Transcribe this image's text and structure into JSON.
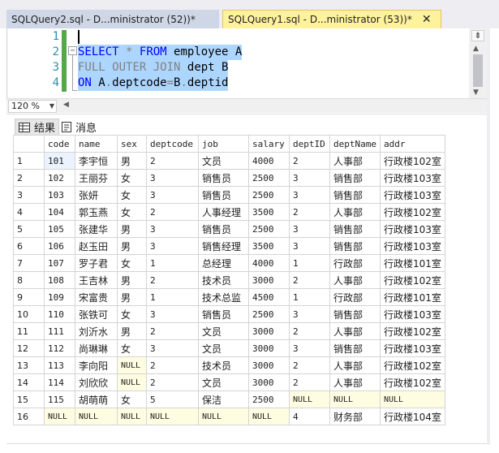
{
  "tabs": [
    {
      "label": "SQLQuery2.sql - D...ministrator (52))*",
      "active": false
    },
    {
      "label": "SQLQuery1.sql - D...ministrator (53))*",
      "active": true,
      "close": "✕"
    }
  ],
  "editor": {
    "line_numbers": [
      "1",
      "2",
      "3",
      "4"
    ],
    "lines": [
      [],
      [
        {
          "t": "SELECT",
          "c": "kw"
        },
        {
          "t": " ",
          "c": "plain"
        },
        {
          "t": "*",
          "c": "gray"
        },
        {
          "t": " ",
          "c": "plain"
        },
        {
          "t": "FROM",
          "c": "kw"
        },
        {
          "t": " employee A",
          "c": "plain"
        }
      ],
      [
        {
          "t": "FULL",
          "c": "gray"
        },
        {
          "t": " ",
          "c": "plain"
        },
        {
          "t": "OUTER",
          "c": "gray"
        },
        {
          "t": " ",
          "c": "plain"
        },
        {
          "t": "JOIN",
          "c": "gray"
        },
        {
          "t": " dept B",
          "c": "plain"
        }
      ],
      [
        {
          "t": "ON",
          "c": "kw"
        },
        {
          "t": " A",
          "c": "plain"
        },
        {
          "t": ".",
          "c": "gray"
        },
        {
          "t": "deptcode",
          "c": "plain"
        },
        {
          "t": "=",
          "c": "gray"
        },
        {
          "t": "B",
          "c": "plain"
        },
        {
          "t": ".",
          "c": "gray"
        },
        {
          "t": "deptid",
          "c": "plain"
        }
      ]
    ],
    "fold_symbol": "−"
  },
  "zoom": {
    "value": "120 %"
  },
  "results_tabs": {
    "results": "结果",
    "messages": "消息"
  },
  "grid": {
    "columns": [
      "code",
      "name",
      "sex",
      "deptcode",
      "job",
      "salary",
      "deptID",
      "deptName",
      "addr"
    ],
    "rows": [
      [
        "1",
        "101",
        "李宇恒",
        "男",
        "2",
        "文员",
        "4000",
        "2",
        "人事部",
        "行政楼102室"
      ],
      [
        "2",
        "102",
        "王丽芬",
        "女",
        "3",
        "销售员",
        "2500",
        "3",
        "销售部",
        "行政楼103室"
      ],
      [
        "3",
        "103",
        "张妍",
        "女",
        "3",
        "销售员",
        "2500",
        "3",
        "销售部",
        "行政楼103室"
      ],
      [
        "4",
        "104",
        "郭玉燕",
        "女",
        "2",
        "人事经理",
        "3500",
        "2",
        "人事部",
        "行政楼102室"
      ],
      [
        "5",
        "105",
        "张建华",
        "男",
        "3",
        "销售员",
        "2500",
        "3",
        "销售部",
        "行政楼103室"
      ],
      [
        "6",
        "106",
        "赵玉田",
        "男",
        "3",
        "销售经理",
        "3500",
        "3",
        "销售部",
        "行政楼103室"
      ],
      [
        "7",
        "107",
        "罗子君",
        "女",
        "1",
        "总经理",
        "4000",
        "1",
        "行政部",
        "行政楼101室"
      ],
      [
        "8",
        "108",
        "王吉林",
        "男",
        "2",
        "技术员",
        "3000",
        "2",
        "人事部",
        "行政楼102室"
      ],
      [
        "9",
        "109",
        "宋富贵",
        "男",
        "1",
        "技术总监",
        "4500",
        "1",
        "行政部",
        "行政楼101室"
      ],
      [
        "10",
        "110",
        "张铁可",
        "女",
        "3",
        "销售员",
        "2500",
        "3",
        "销售部",
        "行政楼103室"
      ],
      [
        "11",
        "111",
        "刘沂水",
        "男",
        "2",
        "文员",
        "3000",
        "2",
        "人事部",
        "行政楼102室"
      ],
      [
        "12",
        "112",
        "尚琳琳",
        "女",
        "3",
        "文员",
        "3000",
        "3",
        "销售部",
        "行政楼103室"
      ],
      [
        "13",
        "113",
        "李向阳",
        "NULL",
        "2",
        "技术员",
        "3000",
        "2",
        "人事部",
        "行政楼102室"
      ],
      [
        "14",
        "114",
        "刘欣欣",
        "NULL",
        "2",
        "文员",
        "3000",
        "2",
        "人事部",
        "行政楼102室"
      ],
      [
        "15",
        "115",
        "胡萌萌",
        "女",
        "5",
        "保洁",
        "2500",
        "NULL",
        "NULL",
        "NULL"
      ],
      [
        "16",
        "NULL",
        "NULL",
        "NULL",
        "NULL",
        "NULL",
        "NULL",
        "4",
        "财务部",
        "行政楼104室"
      ]
    ]
  },
  "colors": {
    "selection": "#add6ff",
    "active_tab": "#fff29d",
    "null_cell": "#fffde1",
    "keyword": "#0000ff"
  }
}
